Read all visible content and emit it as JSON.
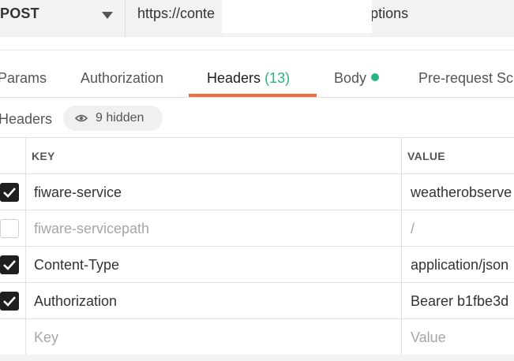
{
  "request": {
    "method": "POST",
    "url": "https://conte                         2/subscriptions"
  },
  "tabs": [
    {
      "label": "Params"
    },
    {
      "label": "Authorization"
    },
    {
      "label": "Headers",
      "count": "(13)",
      "active": true
    },
    {
      "label": "Body",
      "has_content": true
    },
    {
      "label": "Pre-request Sc"
    }
  ],
  "headers_section": {
    "title": "Headers",
    "hidden_label": "9 hidden"
  },
  "table": {
    "columns": [
      "KEY",
      "VALUE"
    ],
    "rows": [
      {
        "enabled": true,
        "key": "fiware-service",
        "value": "weatherobserve"
      },
      {
        "enabled": false,
        "key": "fiware-servicepath",
        "value": "/"
      },
      {
        "enabled": true,
        "key": "Content-Type",
        "value": "application/json"
      },
      {
        "enabled": true,
        "key": "Authorization",
        "value": "Bearer b1fbe3d"
      }
    ],
    "new_row": {
      "key_placeholder": "Key",
      "value_placeholder": "Value"
    }
  },
  "colors": {
    "active_tab_indicator": "#f26b3a",
    "count_green": "#26b47f",
    "checkbox_checked": "#1f1f1f"
  },
  "icons": {
    "eye": "eye-icon",
    "check": "check-icon",
    "dropdown": "chevron-down-icon"
  }
}
